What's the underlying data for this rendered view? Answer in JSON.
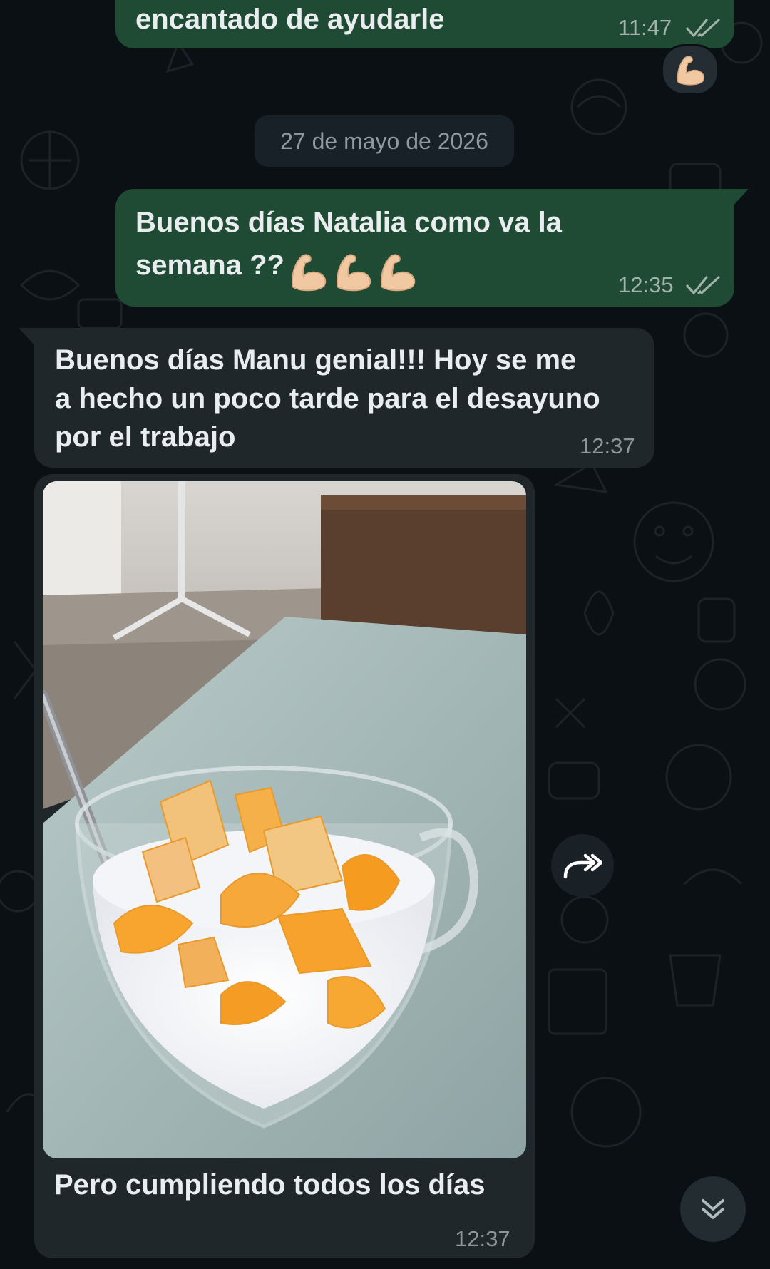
{
  "messages": {
    "prev_out": {
      "text": "encantado de ayudarle",
      "time": "11:47",
      "reaction": "muscle-emoji"
    },
    "date_divider": "27 de mayo de 2026",
    "out_1": {
      "line1": "Buenos días Natalia como va la",
      "line2": "semana ??",
      "emoji": [
        "muscle-emoji",
        "muscle-emoji",
        "muscle-emoji"
      ],
      "time": "12:35"
    },
    "in_1": {
      "line1": "Buenos días Manu genial!!! Hoy se me",
      "line2": "a hecho un poco tarde para el desayuno",
      "line3": "por el trabajo",
      "time": "12:37"
    },
    "in_photo": {
      "caption": "Pero cumpliendo todos los días",
      "time": "12:37",
      "image": "photo-yogurt-orange-cup"
    }
  },
  "icons": {
    "forward": "forward-icon",
    "scroll_down": "double-chevron-down-icon",
    "read_status": "double-check-icon"
  },
  "colors": {
    "outgoing": "#1f4a33",
    "incoming": "#1f272b",
    "background": "#0b1014"
  }
}
